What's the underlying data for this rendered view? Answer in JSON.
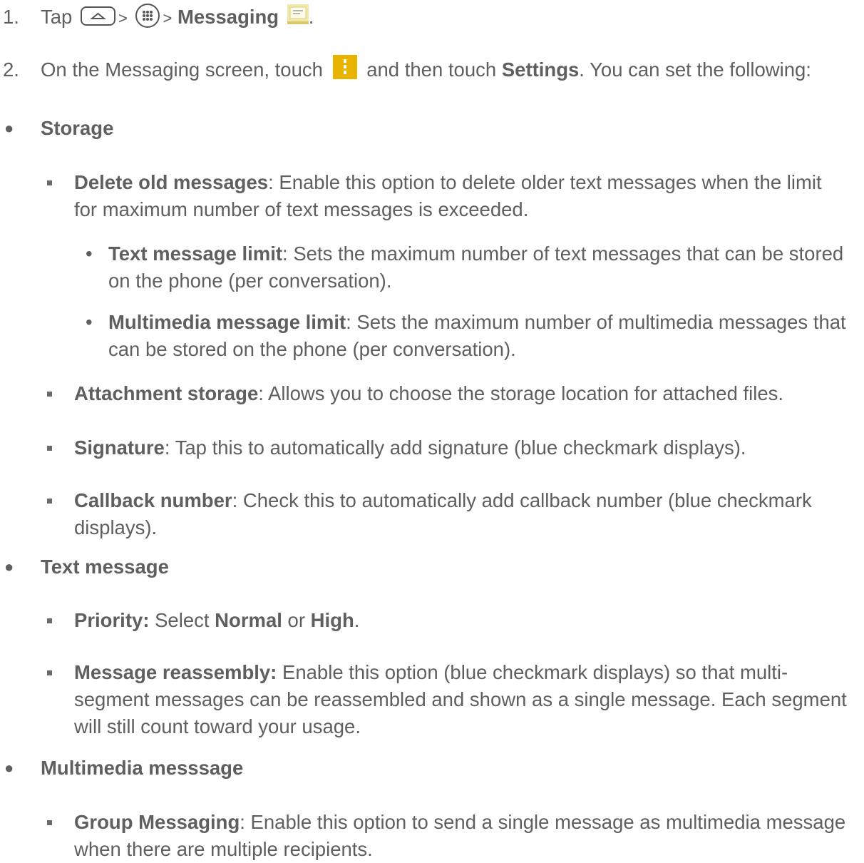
{
  "steps": [
    {
      "num": "1.",
      "tap": "Tap",
      "gt1": ">",
      "gt2": ">",
      "app": "Messaging",
      "end": "."
    },
    {
      "num": "2.",
      "pre": "On the Messaging screen, touch",
      "mid": "and then touch",
      "settings": "Settings",
      "post": ". You can set the following:"
    }
  ],
  "icons": {
    "home": "home-key-icon",
    "apps": "apps-key-icon",
    "messaging": "messaging-app-icon",
    "menu": "menu-icon",
    "menu_color": "#e8b400",
    "messaging_color": "#f2e9a8"
  },
  "sections": {
    "storage": {
      "title": "Storage",
      "delete": {
        "term": "Delete old messages",
        "desc": ": Enable this option to delete older text messages when the limit for maximum number of text messages is exceeded."
      },
      "text_limit": {
        "term": "Text message limit",
        "desc": ": Sets the maximum number of text messages that can be stored on the phone (per conversation)."
      },
      "mm_limit": {
        "term": "Multimedia message limit",
        "desc": ": Sets the maximum number of multimedia messages that can be stored on the phone (per conversation)."
      },
      "attachment": {
        "term": "Attachment storage",
        "desc": ": Allows you to choose the storage location for attached files."
      },
      "signature": {
        "term": "Signature",
        "desc": ": Tap this to automatically add signature (blue checkmark displays)."
      },
      "callback": {
        "term": "Callback number",
        "desc": ": Check this to automatically add callback number (blue checkmark displays)."
      }
    },
    "text": {
      "title": "Text message",
      "priority": {
        "term": "Priority:",
        "pre": " Select ",
        "normal": "Normal",
        "or": " or ",
        "high": "High",
        "end": "."
      },
      "reassembly": {
        "term": "Message reassembly:",
        "desc": " Enable this option (blue checkmark displays) so that multi-segment messages can be reassembled and shown as a single message. Each segment will still count toward your usage."
      }
    },
    "multimedia": {
      "title": "Multimedia messsage",
      "group": {
        "term": "Group Messaging",
        "desc": ": Enable this option to send a single message as multimedia message when there are multiple recipients."
      }
    }
  },
  "bullets": {
    "round": "●",
    "dot": "•"
  }
}
